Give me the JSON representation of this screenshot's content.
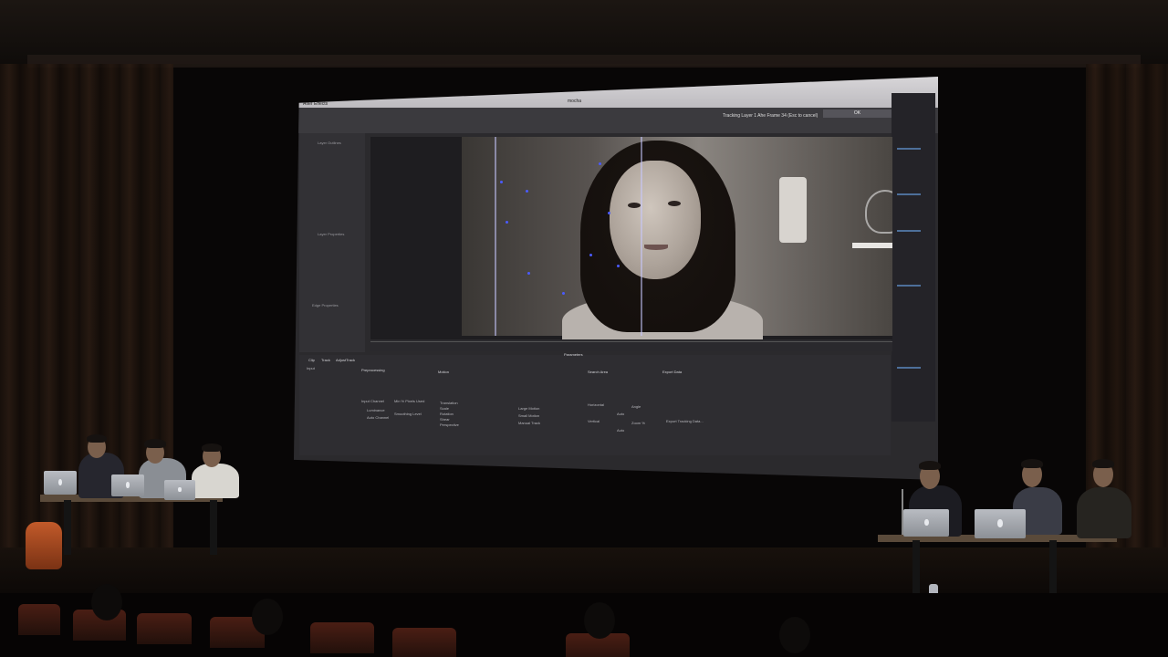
{
  "screen": {
    "menu_app": "After Effects",
    "doc_title": "mocha",
    "clock": "",
    "tracking_status": "Tracking Layer 1 Ahe Frame 34 (Esc to cancel)",
    "ok_label": "OK",
    "left_panel_labels": [
      "Layer Outlines",
      "Layer Properties",
      "Edge Properties"
    ],
    "params": {
      "tabs": [
        "Clip",
        "Track",
        "AdjustTrack"
      ],
      "headers": [
        "Preprocessing",
        "Motion",
        "Search Area",
        "Export Data",
        "Parameters"
      ],
      "input_label": "Input",
      "channel": "Input Channel",
      "options": [
        "Luminance",
        "Auto Channel"
      ],
      "min_pixels": "Min % Pixels Used",
      "smoothing": "Smoothing Level",
      "motion_opts": [
        "Translation",
        "Scale",
        "Rotation",
        "Shear",
        "Perspective"
      ],
      "track_modes": [
        "Large Motion",
        "Small Motion",
        "Manual Track"
      ],
      "search_labels": [
        "Horizontal",
        "Vertical",
        "Angle",
        "Zoom %",
        "Auto",
        "Auto"
      ],
      "export_button": "Export Tracking Data..."
    }
  },
  "colors": {
    "screen_bg": "#2b2a2d",
    "track_point": "#4a5bff",
    "seat": "#4a1e14",
    "bag": "#c25a2a"
  }
}
